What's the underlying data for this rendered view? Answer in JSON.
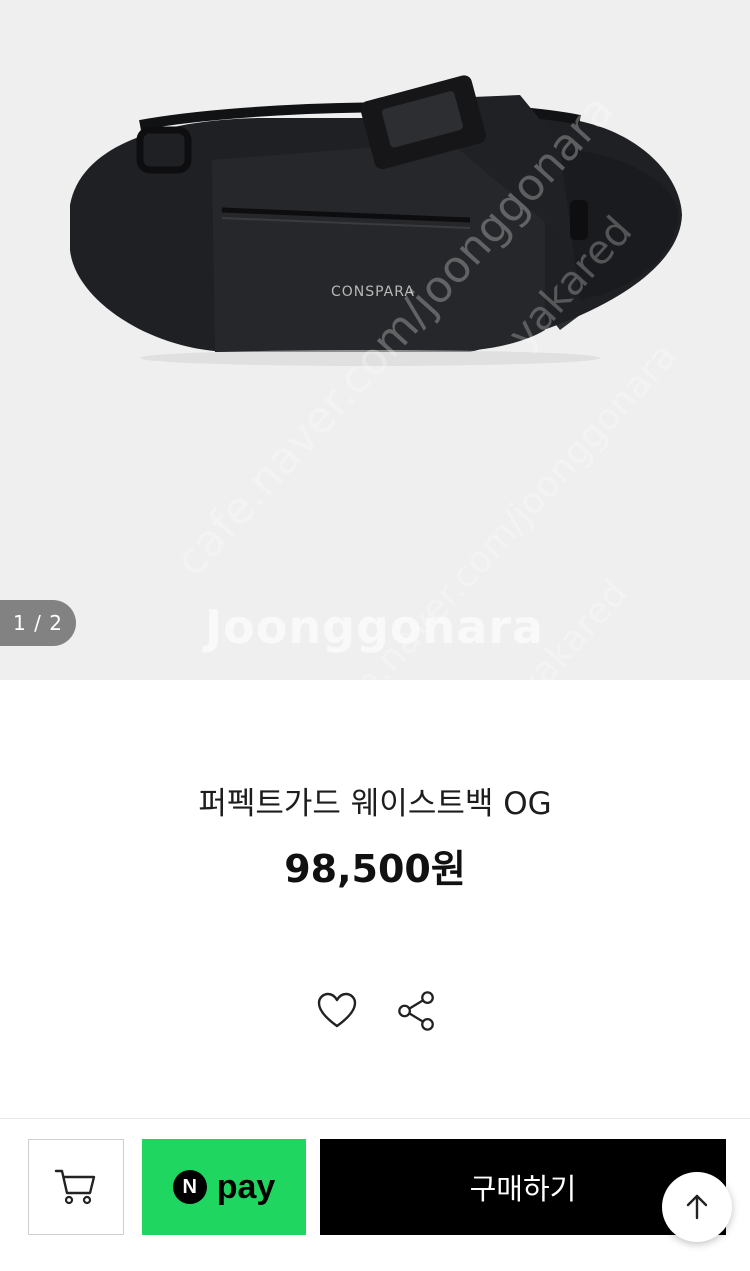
{
  "gallery": {
    "counter": "1 / 2",
    "brand_logo": "CONSPARA",
    "watermark_main": "Joonggonara",
    "watermark_url": "cafe.naver.com/joonggonara",
    "watermark_url_short": "cafe.naver.com/joonggonara",
    "watermark_user": "yakared",
    "watermark_user_2": "yakared"
  },
  "product": {
    "title": "퍼펙트가드 웨이스트백 OG",
    "price": "98,500원"
  },
  "actions": {
    "like_icon": "heart-icon",
    "share_icon": "share-icon"
  },
  "bottom_bar": {
    "cart_icon": "cart-icon",
    "npay_badge": "N",
    "npay_label": "pay",
    "buy_label": "구매하기",
    "scroll_top_icon": "arrow-up-icon",
    "overlay_watermark": "joonggonara"
  },
  "colors": {
    "npay_green": "#1fd660",
    "buy_black": "#000000",
    "hero_bg": "#efefef"
  }
}
